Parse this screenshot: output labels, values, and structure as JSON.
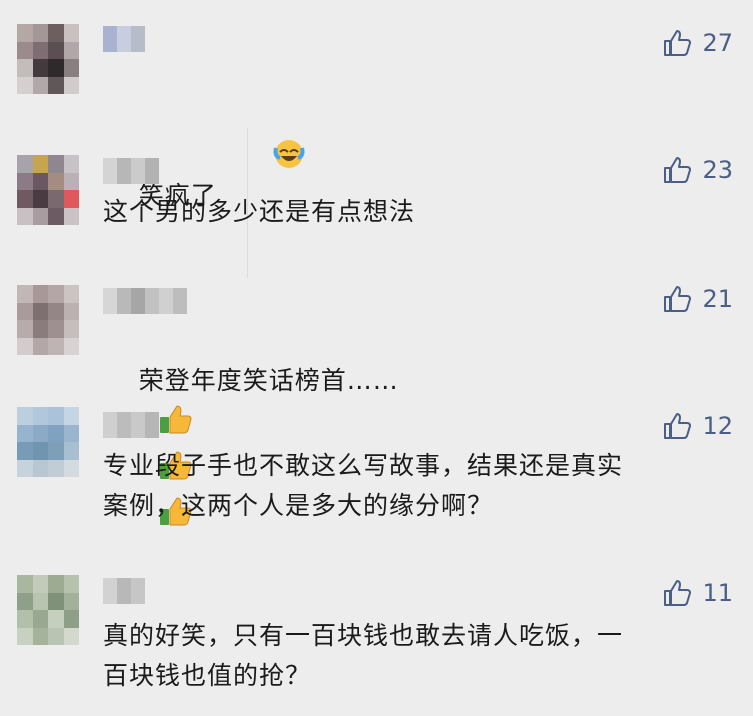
{
  "comments": [
    {
      "text": "笑疯了",
      "emoji": "laughing-crying-emoji",
      "likes": "27"
    },
    {
      "text": "这个男的多少还是有点想法",
      "likes": "23"
    },
    {
      "text": "荣登年度笑话榜首……",
      "emoji": "thumbs-up-emoji",
      "emoji_count": 3,
      "likes": "21"
    },
    {
      "text": "专业段子手也不敢这么写故事，结果还是真实\n案例，这两个人是多大的缘分啊？",
      "likes": "12"
    },
    {
      "text": "真的好笑，只有一百块钱也敢去请人吃饭，一\n百块钱也值的抢？",
      "likes": "11"
    }
  ],
  "colors": {
    "like": "#4a5e86",
    "text": "#1b1b1b",
    "background": "#ededed"
  }
}
